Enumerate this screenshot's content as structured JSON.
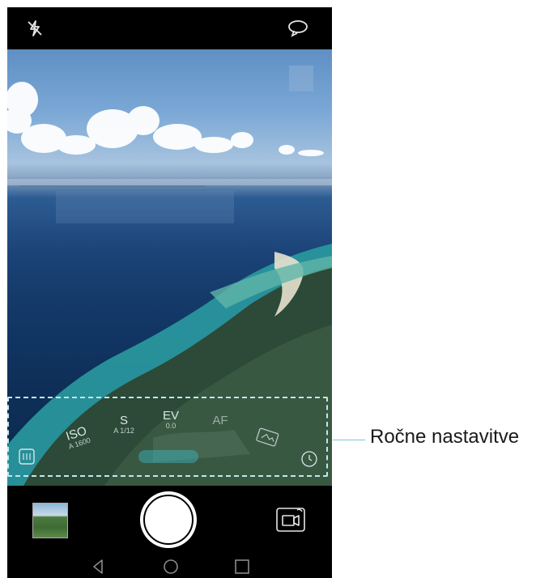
{
  "camera": {
    "manual_controls": [
      {
        "key": "ISO",
        "value": "A 1600"
      },
      {
        "key": "S",
        "value": "A 1/12"
      },
      {
        "key": "EV",
        "value": "0.0"
      },
      {
        "key": "AF",
        "value": ""
      }
    ]
  },
  "callout": {
    "label": "Ročne nastavitve"
  },
  "colors": {
    "accent_dashed": "#bfe7ef",
    "callout_line": "#79c7d6"
  },
  "icons": [
    "flash-off-icon",
    "flip-camera-icon",
    "filter-icon",
    "white-balance-icon",
    "timer-icon",
    "switch-to-video-icon",
    "back-icon",
    "home-icon",
    "recents-icon"
  ]
}
